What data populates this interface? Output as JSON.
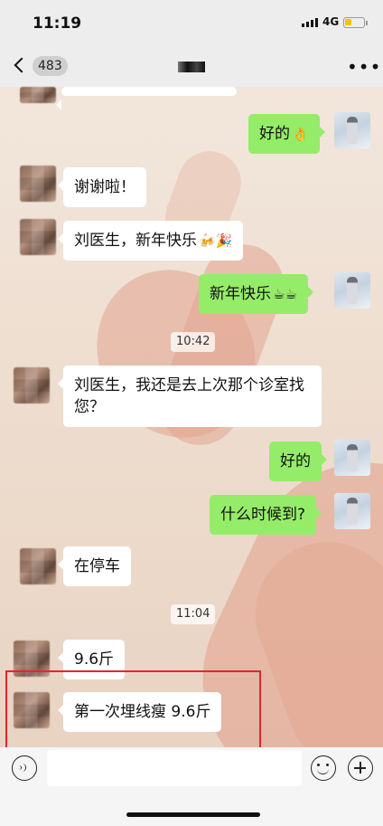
{
  "status_bar": {
    "time": "11:19",
    "network": "4G",
    "battery_level": 0.3,
    "battery_color": "#f4c400"
  },
  "nav": {
    "unread_count": "483",
    "back_icon": "chevron-left-icon",
    "more_icon": "more-dots-icon"
  },
  "messages": [
    {
      "side": "right",
      "text": "好的",
      "emoji": "👌"
    },
    {
      "side": "left",
      "text": "谢谢啦！"
    },
    {
      "side": "left",
      "text": "刘医生，新年快乐",
      "emoji": "🍻🎉"
    },
    {
      "side": "right",
      "text": "新年快乐",
      "emoji": "☕☕"
    },
    {
      "type": "time",
      "text": "10:42"
    },
    {
      "side": "left",
      "text": "刘医生，我还是去上次那个诊室找您？"
    },
    {
      "side": "right",
      "text": "好的"
    },
    {
      "side": "right",
      "text": "什么时候到?"
    },
    {
      "side": "left",
      "text": "在停车"
    },
    {
      "type": "time",
      "text": "11:04"
    },
    {
      "side": "left",
      "text": "9.6斤"
    },
    {
      "side": "left",
      "text": "第一次埋线瘦 9.6斤"
    }
  ],
  "colors": {
    "bubble_self": "#95ec69",
    "bubble_other": "#ffffff",
    "highlight": "#e8232e"
  },
  "input_bar": {
    "voice_icon": "voice-icon",
    "emoji_icon": "smiley-icon",
    "plus_icon": "plus-icon"
  }
}
